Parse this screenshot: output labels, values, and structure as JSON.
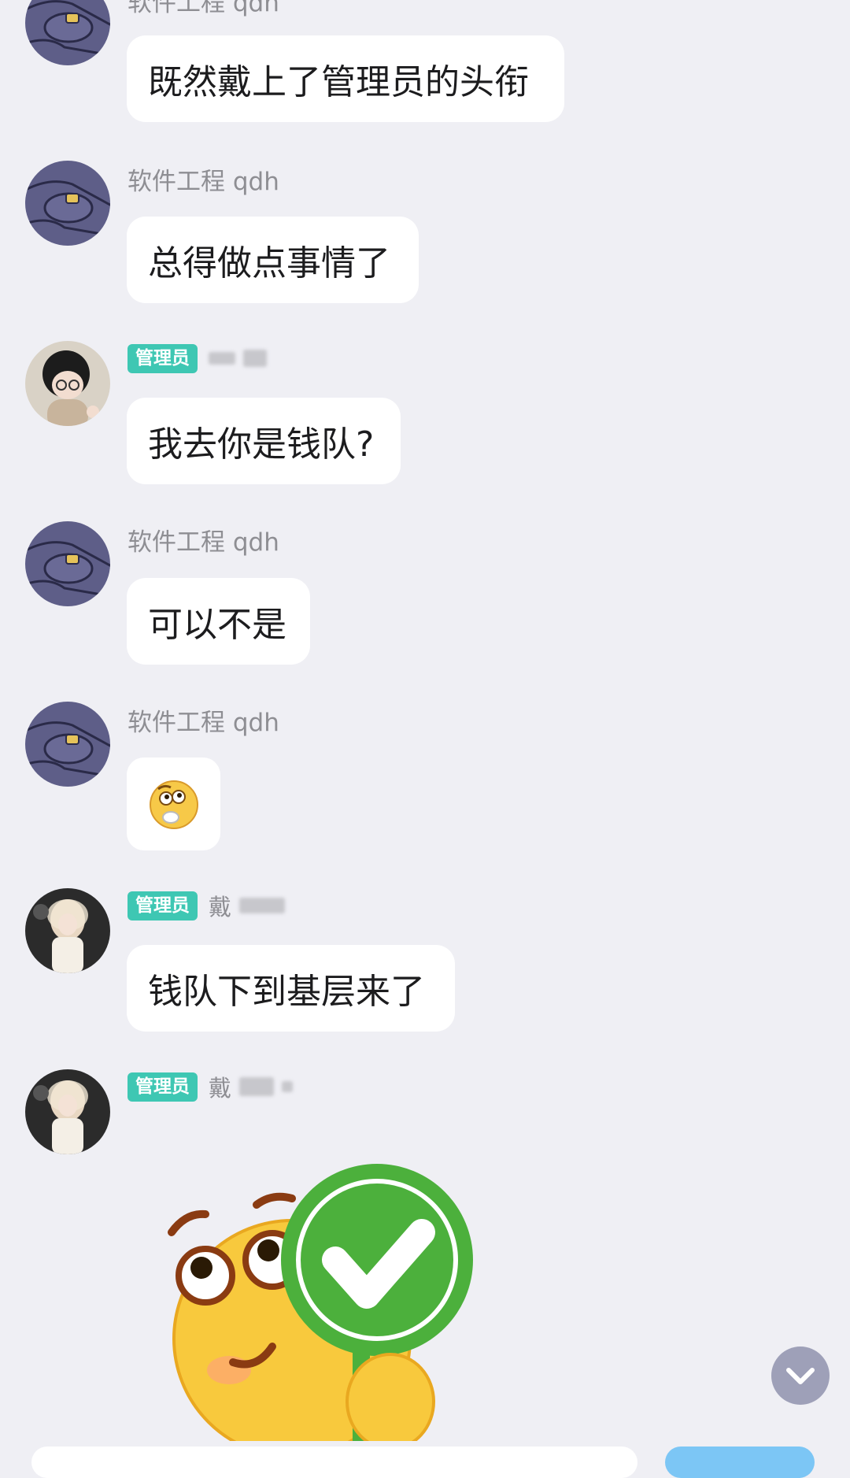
{
  "messages": [
    {
      "type": "text",
      "sender": "软件工程 qdh",
      "text": "既然戴上了管理员的头衔"
    },
    {
      "type": "text",
      "sender": "软件工程 qdh",
      "text": "总得做点事情了"
    },
    {
      "type": "text",
      "sender_role": "管理员",
      "sender_blurred": true,
      "text": "我去你是钱队?"
    },
    {
      "type": "text",
      "sender": "软件工程 qdh",
      "text": "可以不是"
    },
    {
      "type": "emoji",
      "sender": "软件工程 qdh",
      "emoji": "thinking-face-sticker"
    },
    {
      "type": "text",
      "sender_role": "管理员",
      "sender_name_partial": "戴",
      "sender_blurred": true,
      "text": "钱队下到基层来了"
    },
    {
      "type": "sticker",
      "sender_role": "管理员",
      "sender_name_partial": "戴",
      "sender_blurred": true,
      "sticker": "emoji-holding-green-check-sign"
    }
  ],
  "colors": {
    "background": "#efeff4",
    "bubble": "#ffffff",
    "admin_badge": "#3ec7b3",
    "sender_text": "#8e8e93",
    "check_green": "#4cb03c"
  },
  "icons": {
    "scroll_down": "chevron-down-icon"
  }
}
